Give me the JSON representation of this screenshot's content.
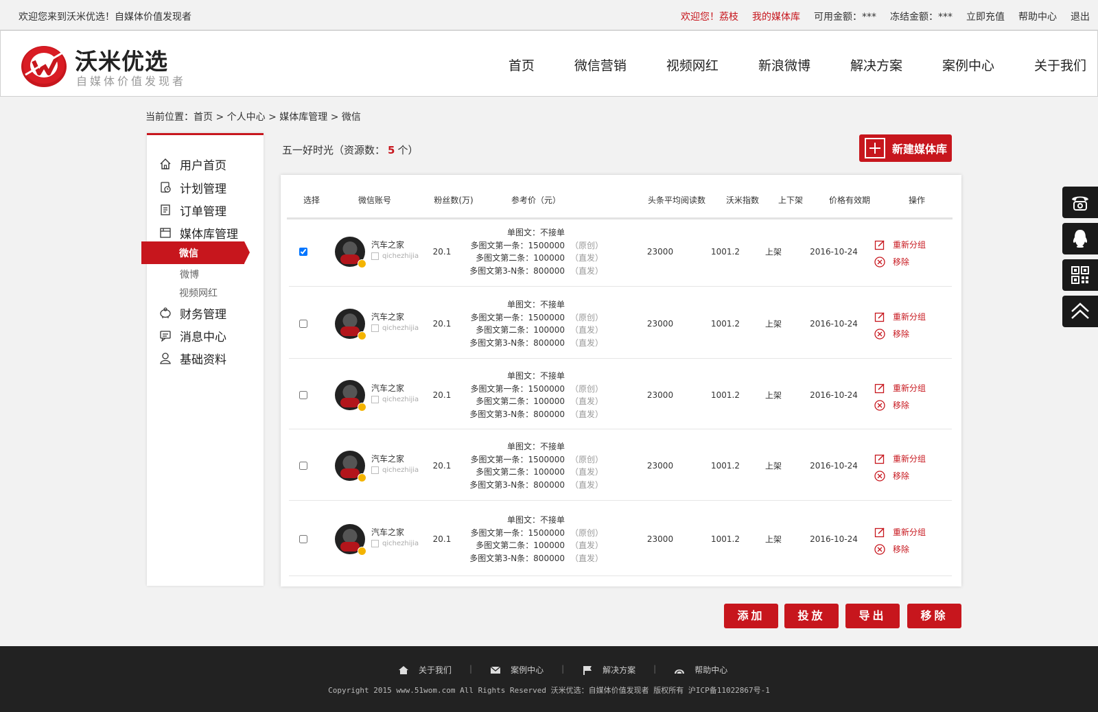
{
  "topbar": {
    "welcome": "欢迎您来到沃米优选！自媒体价值发现者",
    "greeting": "欢迎您！荔枝",
    "my_media": "我的媒体库",
    "available": "可用金额：***",
    "frozen": "冻结金额：***",
    "recharge": "立即充值",
    "help": "帮助中心",
    "logout": "退出"
  },
  "logo": {
    "name": "沃米优选",
    "slogan": "自媒体价值发现者"
  },
  "nav": [
    "首页",
    "微信营销",
    "视频网红",
    "新浪微博",
    "解决方案",
    "案例中心",
    "关于我们"
  ],
  "breadcrumb": "当前位置：首页 > 个人中心 > 媒体库管理 > 微信",
  "sidebar": {
    "user_home": "用户首页",
    "plan": "计划管理",
    "order": "订单管理",
    "media": "媒体库管理",
    "sub_wechat": "微信",
    "sub_weibo": "微博",
    "sub_video": "视频网红",
    "finance": "财务管理",
    "message": "消息中心",
    "profile": "基础资料"
  },
  "group": {
    "name": "五一好时光（资源数：",
    "count": "5",
    "suffix": "个）"
  },
  "new_button": "新建媒体库",
  "table": {
    "headers": [
      "选择",
      "微信账号",
      "粉丝数(万)",
      "参考价（元）",
      "头条平均阅读数",
      "沃米指数",
      "上下架",
      "价格有效期",
      "操作"
    ],
    "rows": [
      {
        "checked": true,
        "name": "汽车之家",
        "id": "qichezhijia",
        "fans": "20.1",
        "price1": "单图文：不接单",
        "price2": "多图文第一条：1500000",
        "tag2": "（原创）",
        "price3": "多图文第二条：100000",
        "tag3": "（直发）",
        "price4": "多图文第3-N条：800000",
        "tag4": "（直发）",
        "reads": "23000",
        "index": "1001.2",
        "status": "上架",
        "valid": "2016-10-24",
        "op1": "重新分组",
        "op2": "移除"
      },
      {
        "checked": false,
        "name": "汽车之家",
        "id": "qichezhijia",
        "fans": "20.1",
        "price1": "单图文：不接单",
        "price2": "多图文第一条：1500000",
        "tag2": "（原创）",
        "price3": "多图文第二条：100000",
        "tag3": "（直发）",
        "price4": "多图文第3-N条：800000",
        "tag4": "（直发）",
        "reads": "23000",
        "index": "1001.2",
        "status": "上架",
        "valid": "2016-10-24",
        "op1": "重新分组",
        "op2": "移除"
      },
      {
        "checked": false,
        "name": "汽车之家",
        "id": "qichezhijia",
        "fans": "20.1",
        "price1": "单图文：不接单",
        "price2": "多图文第一条：1500000",
        "tag2": "（原创）",
        "price3": "多图文第二条：100000",
        "tag3": "（直发）",
        "price4": "多图文第3-N条：800000",
        "tag4": "（直发）",
        "reads": "23000",
        "index": "1001.2",
        "status": "上架",
        "valid": "2016-10-24",
        "op1": "重新分组",
        "op2": "移除"
      },
      {
        "checked": false,
        "name": "汽车之家",
        "id": "qichezhijia",
        "fans": "20.1",
        "price1": "单图文：不接单",
        "price2": "多图文第一条：1500000",
        "tag2": "（原创）",
        "price3": "多图文第二条：100000",
        "tag3": "（直发）",
        "price4": "多图文第3-N条：800000",
        "tag4": "（直发）",
        "reads": "23000",
        "index": "1001.2",
        "status": "上架",
        "valid": "2016-10-24",
        "op1": "重新分组",
        "op2": "移除"
      },
      {
        "checked": false,
        "name": "汽车之家",
        "id": "qichezhijia",
        "fans": "20.1",
        "price1": "单图文：不接单",
        "price2": "多图文第一条：1500000",
        "tag2": "（原创）",
        "price3": "多图文第二条：100000",
        "tag3": "（直发）",
        "price4": "多图文第3-N条：800000",
        "tag4": "（直发）",
        "reads": "23000",
        "index": "1001.2",
        "status": "上架",
        "valid": "2016-10-24",
        "op1": "重新分组",
        "op2": "移除"
      }
    ]
  },
  "actions": {
    "add": "添加",
    "deliver": "投放",
    "export": "导出",
    "remove": "移除"
  },
  "footer": {
    "about": "关于我们",
    "cases": "案例中心",
    "solutions": "解决方案",
    "help": "帮助中心",
    "separator": "|",
    "copyright": "Copyright 2015 www.51wom.com All Rights Reserved 沃米优选：自媒体价值发现者 版权所有 沪ICP备11022867号-1"
  },
  "colors": {
    "accent": "#c7161d",
    "footer_bg": "#222222",
    "page_bg": "#f2f2f2"
  },
  "icons": [
    "home-icon",
    "plan-icon",
    "order-icon",
    "media-icon",
    "finance-icon",
    "message-icon",
    "profile-icon",
    "phone-icon",
    "qq-icon",
    "qrcode-icon",
    "back-to-top-icon",
    "edit-icon",
    "remove-icon"
  ]
}
